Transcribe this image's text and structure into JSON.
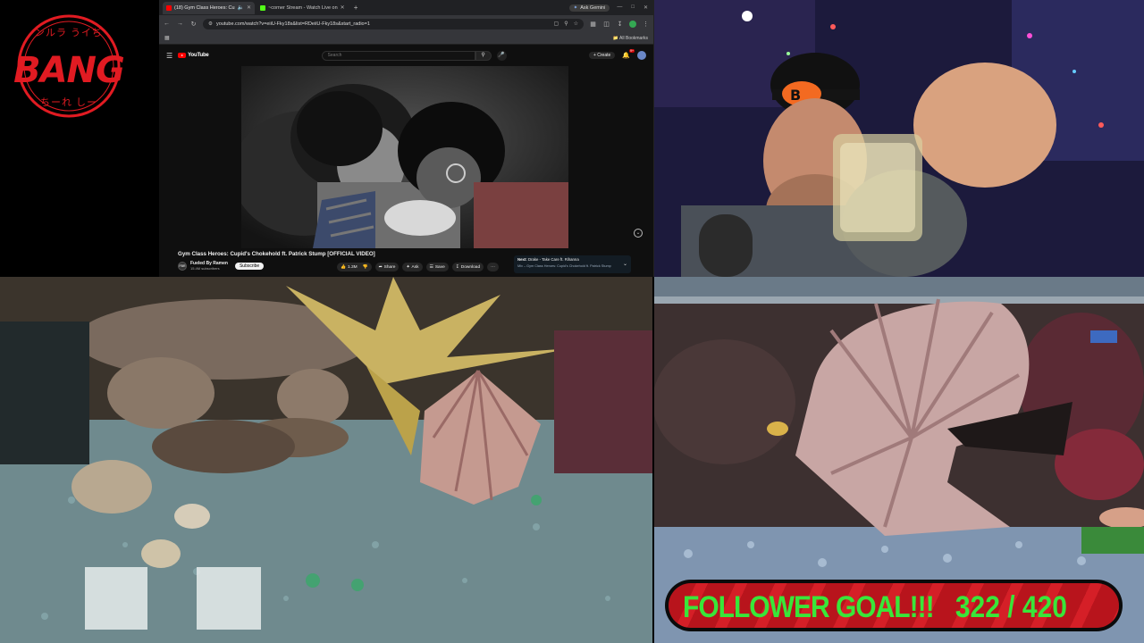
{
  "logo": {
    "text": "BANG",
    "top_text": "ンルラ うイぢ",
    "bottom_text": "ちーれ しー"
  },
  "browser": {
    "tabs": [
      {
        "label": "(18) Gym Class Heroes: Cu",
        "favicon_color": "#ff0000",
        "active": true
      },
      {
        "label": "~corner Stream - Watch Live on",
        "favicon_color": "#53fc18",
        "active": false
      }
    ],
    "new_tab": "+",
    "gemini_label": "Ask Gemini",
    "url": "youtube.com/watch?v=eiiU-Fky18s&list=RDeiiU-Fky18s&start_radio=1",
    "all_bookmarks": "All Bookmarks"
  },
  "youtube": {
    "logo_text": "YouTube",
    "search_placeholder": "Search",
    "create_label": "+ Create",
    "notification_count": "9+",
    "video_title": "Gym Class Heroes: Cupid's Chokehold ft. Patrick Stump [OFFICIAL VIDEO]",
    "channel_initials": "FBR",
    "channel_name": "Fueled By Ramen",
    "subscribers": "15.4M subscribers",
    "subscribe_label": "Subscribe",
    "likes": "1.3M",
    "share_label": "Share",
    "ask_label": "Ask",
    "save_label": "Save",
    "download_label": "Download",
    "more_label": "···",
    "next_label": "Next:",
    "next_song": "Drake - Take Care ft. Rihanna",
    "next_mix": "Mix – Gym Class Heroes: Cupid's Chokehold ft. Patrick Stump"
  },
  "follower_goal": {
    "label": "FOLLOWER GOAL!!!",
    "current": 322,
    "target": 420,
    "count_text": "322 / 420"
  },
  "colors": {
    "brand_red": "#e11b22",
    "goal_green": "#39e639",
    "goal_red": "#c8181f",
    "youtube_red": "#ff0000"
  }
}
